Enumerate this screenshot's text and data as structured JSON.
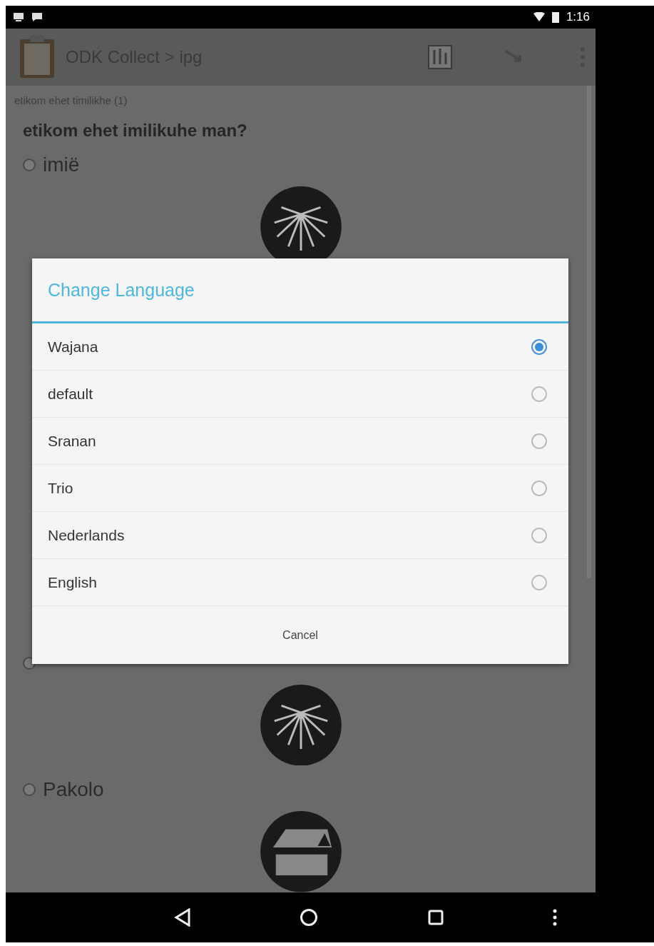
{
  "status_bar": {
    "time": "1:16"
  },
  "app_bar": {
    "title": "ODK Collect > ipg"
  },
  "form": {
    "group_label": "etikom ehet timilikhe (1)",
    "question": "etikom ehet imilikuhe man?",
    "choices": [
      {
        "label": "imië",
        "selected": false,
        "kind": "leaf"
      },
      {
        "selected": false,
        "kind": "leaf"
      },
      {
        "label": "Pakolo",
        "selected": false,
        "kind": "house"
      }
    ]
  },
  "dialog": {
    "title": "Change Language",
    "options": [
      {
        "label": "Wajana",
        "selected": true
      },
      {
        "label": "default",
        "selected": false
      },
      {
        "label": "Sranan",
        "selected": false
      },
      {
        "label": "Trio",
        "selected": false
      },
      {
        "label": "Nederlands",
        "selected": false
      },
      {
        "label": "English",
        "selected": false
      }
    ],
    "cancel": "Cancel"
  }
}
